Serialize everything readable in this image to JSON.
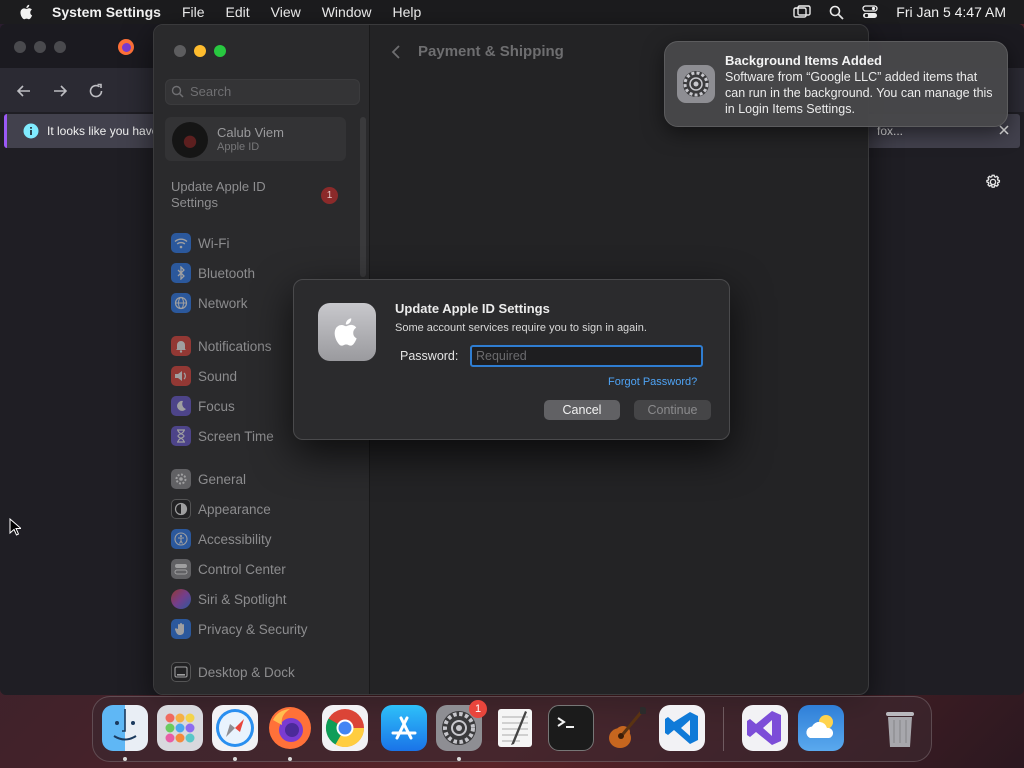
{
  "menubar": {
    "app_name": "System Settings",
    "menus": [
      "File",
      "Edit",
      "View",
      "Window",
      "Help"
    ],
    "datetime": "Fri Jan 5  4:47 AM",
    "icons": [
      "apple-icon",
      "screen-mirroring-icon",
      "spotlight-search-icon",
      "control-center-icon"
    ]
  },
  "browser": {
    "infobar_text": "It looks like you have",
    "infobar_text_right": "fox..."
  },
  "settings": {
    "search_placeholder": "Search",
    "profile": {
      "name": "Calub Viem",
      "subtitle": "Apple ID"
    },
    "update_item": {
      "label": "Update Apple ID Settings",
      "badge": "1"
    },
    "items": [
      {
        "label": "Wi-Fi",
        "icon": "wifi-icon",
        "color": "#2d7ff9"
      },
      {
        "label": "Bluetooth",
        "icon": "bluetooth-icon",
        "color": "#2d7ff9"
      },
      {
        "label": "Network",
        "icon": "globe-icon",
        "color": "#2d7ff9"
      },
      {
        "label": "Notifications",
        "icon": "bell-icon",
        "color": "#e8453c"
      },
      {
        "label": "Sound",
        "icon": "speaker-icon",
        "color": "#e8453c"
      },
      {
        "label": "Focus",
        "icon": "moon-icon",
        "color": "#6b5bd6"
      },
      {
        "label": "Screen Time",
        "icon": "hourglass-icon",
        "color": "#6b5bd6"
      },
      {
        "label": "General",
        "icon": "gear-icon",
        "color": "#8e8e93"
      },
      {
        "label": "Appearance",
        "icon": "appearance-icon",
        "color": "#1c1c1e"
      },
      {
        "label": "Accessibility",
        "icon": "accessibility-icon",
        "color": "#2d7ff9"
      },
      {
        "label": "Control Center",
        "icon": "control-center-icon",
        "color": "#8e8e93"
      },
      {
        "label": "Siri & Spotlight",
        "icon": "siri-icon",
        "color": "#b04fd9"
      },
      {
        "label": "Privacy & Security",
        "icon": "hand-icon",
        "color": "#2d7ff9"
      },
      {
        "label": "Desktop & Dock",
        "icon": "dock-icon",
        "color": "#1c1c1e"
      }
    ],
    "main_title": "Payment & Shipping"
  },
  "dialog": {
    "title": "Update Apple ID Settings",
    "message": "Some account services require you to sign in again.",
    "password_label": "Password:",
    "password_placeholder": "Required",
    "forgot_link": "Forgot Password?",
    "cancel_label": "Cancel",
    "continue_label": "Continue"
  },
  "notification": {
    "title": "Background Items Added",
    "body": "Software from “Google LLC” added items that can run in the background. You can manage this in Login Items Settings."
  },
  "dock": {
    "apps": [
      "Finder",
      "Launchpad",
      "Safari",
      "Firefox",
      "Chrome",
      "App Store",
      "System Settings",
      "TextEdit",
      "Terminal",
      "GarageBand",
      "Visual Studio Code",
      "Visual Studio",
      "Weather",
      "Trash"
    ],
    "system_settings_badge": "1"
  }
}
